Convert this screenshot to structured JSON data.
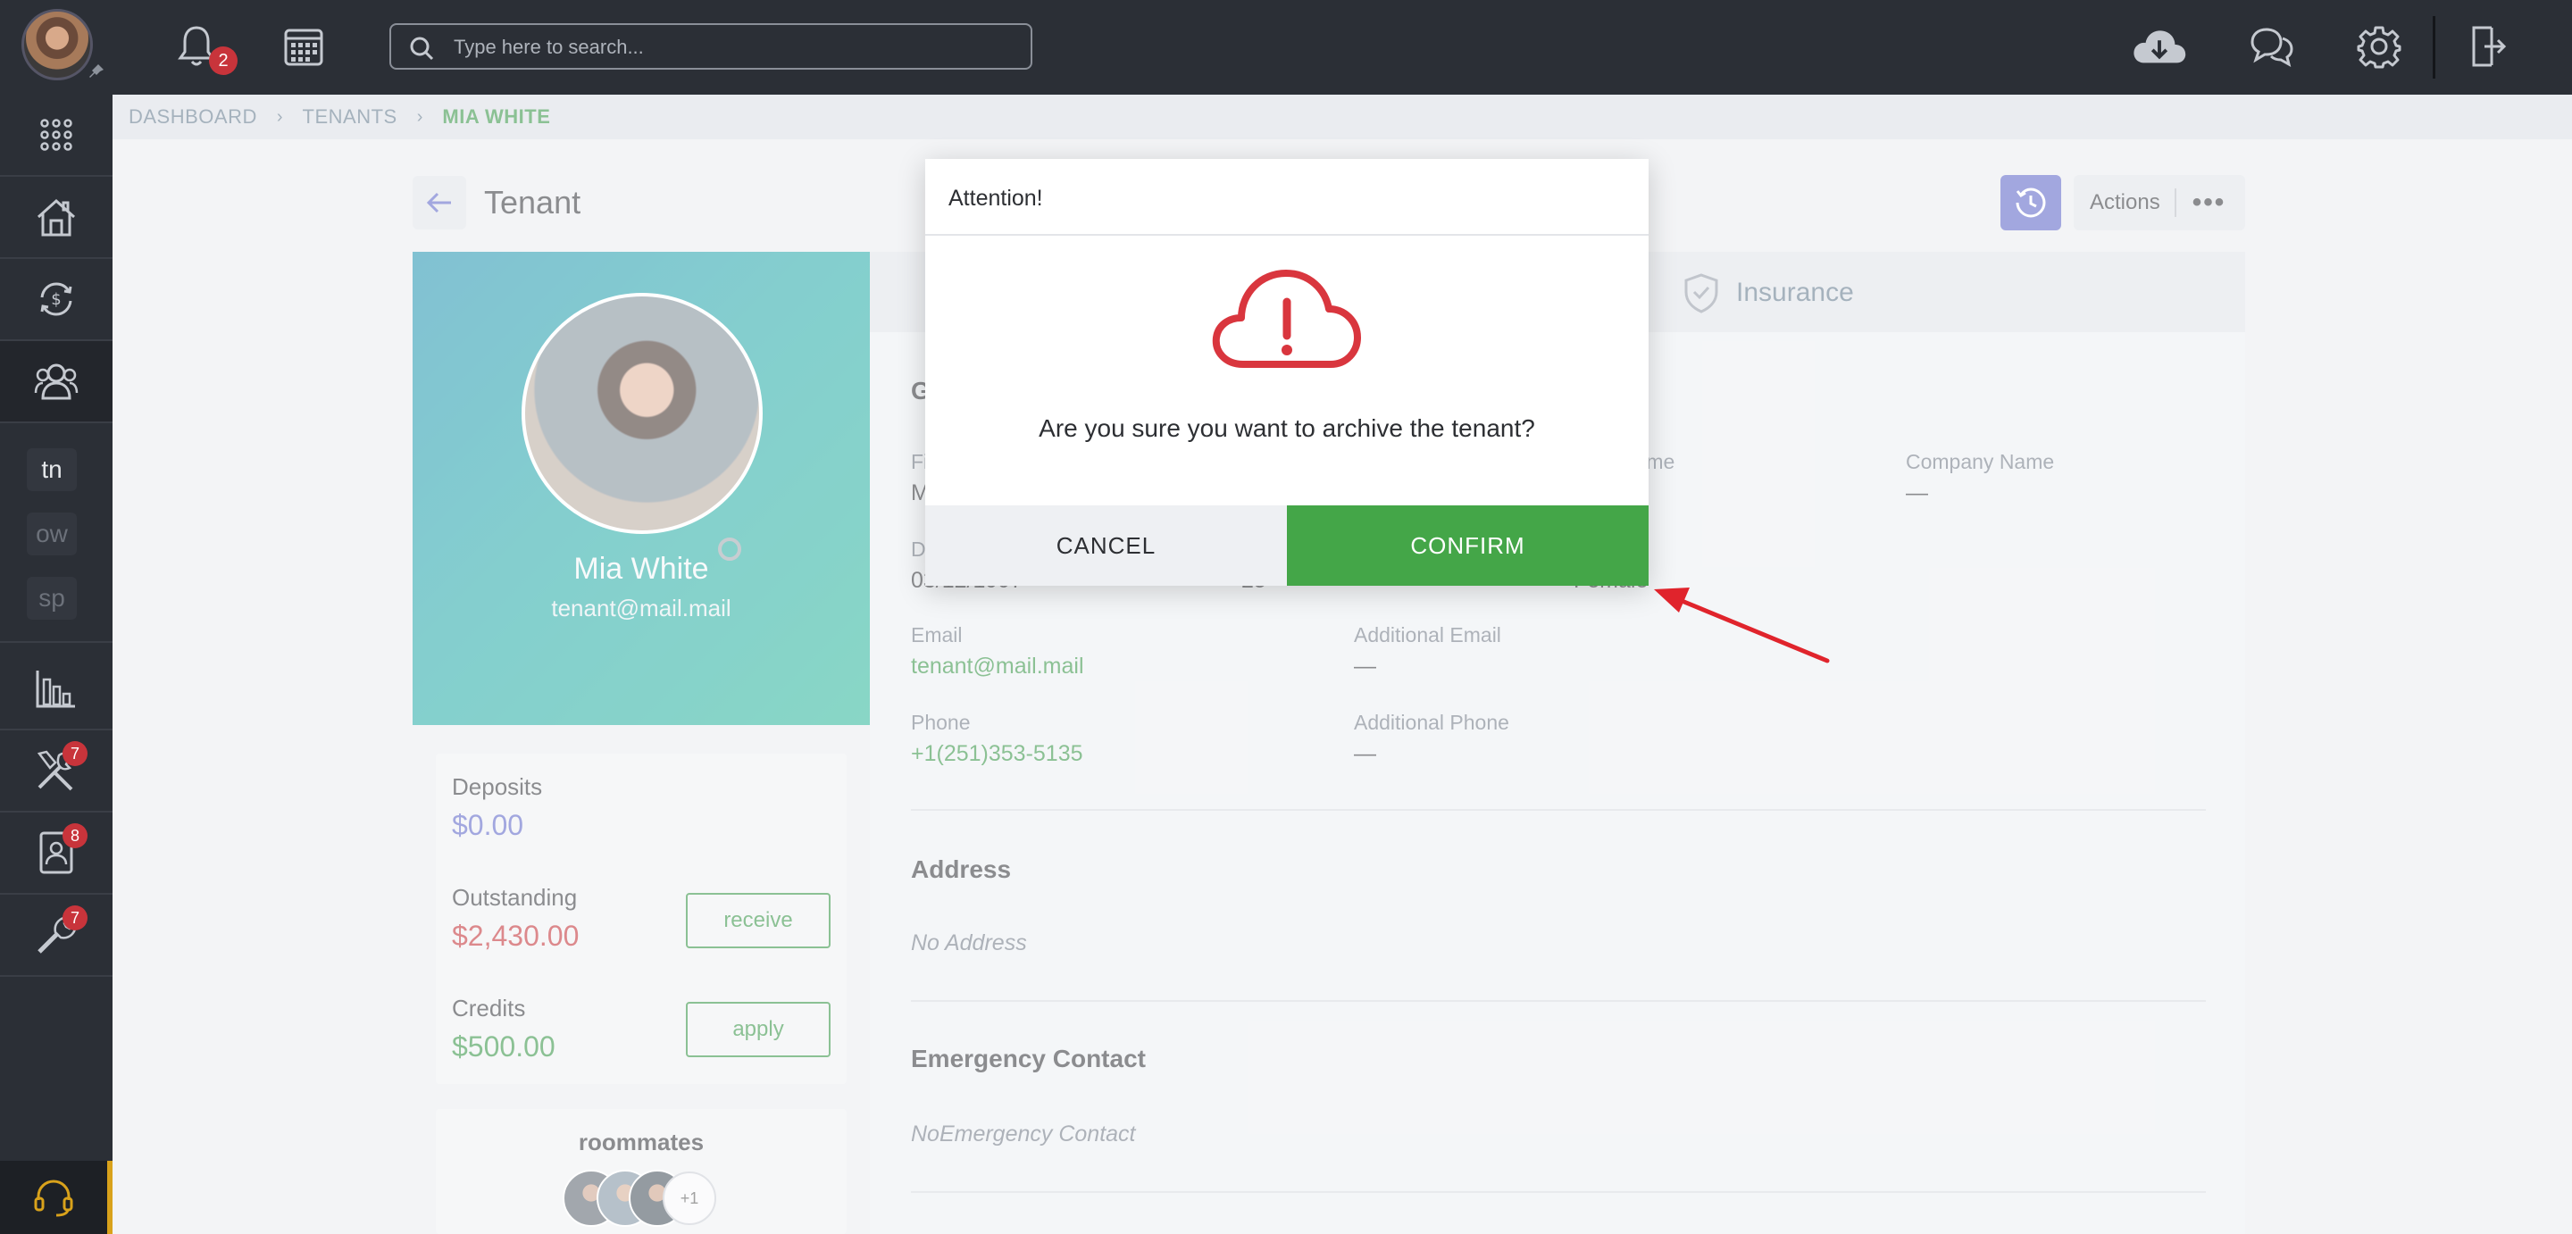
{
  "topbar": {
    "notifications_count": "2",
    "search_placeholder": "Type here to search..."
  },
  "sidebar": {
    "items": [
      {
        "icon": "apps-grid-icon"
      },
      {
        "icon": "house-icon"
      },
      {
        "icon": "dollar-cycle-icon"
      },
      {
        "icon": "users-icon",
        "active": true
      },
      {
        "letter": "tn"
      },
      {
        "letter": "ow"
      },
      {
        "letter": "sp"
      },
      {
        "icon": "bar-chart-icon"
      },
      {
        "icon": "tools-icon",
        "badge": "7"
      },
      {
        "icon": "contact-card-icon",
        "badge": "8"
      },
      {
        "icon": "wrench-icon",
        "badge": "7"
      }
    ]
  },
  "breadcrumb": [
    "DASHBOARD",
    "TENANTS",
    "MIA WHITE"
  ],
  "page": {
    "title": "Tenant",
    "actions_label": "Actions",
    "actions_dots": "•••"
  },
  "profile": {
    "name": "Mia White",
    "email": "tenant@mail.mail"
  },
  "balances": {
    "deposits_label": "Deposits",
    "deposits_value": "$0.00",
    "outstanding_label": "Outstanding",
    "outstanding_value": "$2,430.00",
    "receive_label": "receive",
    "credits_label": "Credits",
    "credits_value": "$500.00",
    "apply_label": "apply"
  },
  "roommates": {
    "title": "roommates",
    "more": "+1"
  },
  "details": {
    "tab_insurance": "Insurance",
    "general_head_partial": "G",
    "first_label_partial": "Fi",
    "first_value_partial": "M",
    "dob_label_partial": "D",
    "dob_value_partial": "03/12/1997",
    "age_value_partial": "25",
    "last_name_label_partial": "Name",
    "gender_value_partial": "Female",
    "company_label": "Company Name",
    "company_value": "—",
    "email_label": "Email",
    "email_value": "tenant@mail.mail",
    "add_email_label": "Additional Email",
    "add_email_value": "—",
    "phone_label": "Phone",
    "phone_value": "+1(251)353-5135",
    "add_phone_label": "Additional Phone",
    "add_phone_value": "—",
    "address_head": "Address",
    "address_value": "No Address",
    "emergency_head": "Emergency Contact",
    "emergency_value": "NoEmergency Contact"
  },
  "dialog": {
    "title": "Attention!",
    "message": "Are you sure you want to archive the tenant?",
    "cancel": "CANCEL",
    "confirm": "CONFIRM"
  },
  "colors": {
    "topbar": "#2b2f36",
    "confirm": "#44a648",
    "alert_icon": "#d9363e",
    "outstanding": "#c0282f",
    "deposits": "#5660c5",
    "credits": "#2d8e3c",
    "arrow": "#e0242c"
  }
}
